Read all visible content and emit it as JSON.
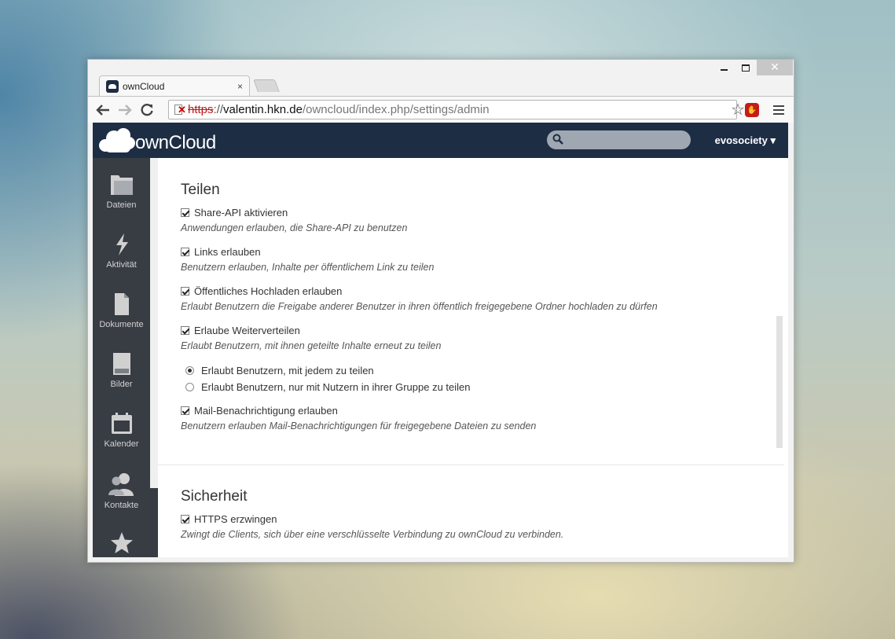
{
  "tab": {
    "title": "ownCloud",
    "close": "×"
  },
  "address": {
    "scheme": "https",
    "sep": "://",
    "host": "valentin.hkn.de",
    "path": "/owncloud/index.php/settings/admin"
  },
  "header": {
    "logo_text": "ownCloud",
    "search_placeholder": "",
    "user": "evosociety ▾"
  },
  "nav": [
    {
      "label": "Dateien",
      "icon": "folder-icon"
    },
    {
      "label": "Aktivität",
      "icon": "lightning-icon"
    },
    {
      "label": "Dokumente",
      "icon": "document-icon"
    },
    {
      "label": "Bilder",
      "icon": "image-icon"
    },
    {
      "label": "Kalender",
      "icon": "calendar-icon"
    },
    {
      "label": "Kontakte",
      "icon": "contacts-icon"
    },
    {
      "label": "",
      "icon": "star-icon"
    }
  ],
  "sharing": {
    "title": "Teilen",
    "options": [
      {
        "label": "Share-API aktivieren",
        "hint": "Anwendungen erlauben, die Share-API zu benutzen",
        "checked": true
      },
      {
        "label": "Links erlauben",
        "hint": "Benutzern erlauben, Inhalte per öffentlichem Link zu teilen",
        "checked": true
      },
      {
        "label": "Öffentliches Hochladen erlauben",
        "hint": "Erlaubt Benutzern die Freigabe anderer Benutzer in ihren öffentlich freigegebene Ordner hochladen zu dürfen",
        "checked": true
      },
      {
        "label": "Erlaube Weiterverteilen",
        "hint": "Erlaubt Benutzern, mit ihnen geteilte Inhalte erneut zu teilen",
        "checked": true
      }
    ],
    "radios": [
      {
        "label": "Erlaubt Benutzern, mit jedem zu teilen",
        "checked": true
      },
      {
        "label": "Erlaubt Benutzern, nur mit Nutzern in ihrer Gruppe zu teilen",
        "checked": false
      }
    ],
    "mail": {
      "label": "Mail-Benachrichtigung erlauben",
      "hint": "Benutzern erlauben Mail-Benachrichtigungen für freigegebene Dateien zu senden",
      "checked": true
    }
  },
  "security": {
    "title": "Sicherheit",
    "https": {
      "label": "HTTPS erzwingen",
      "hint": "Zwingt die Clients, sich über eine verschlüsselte Verbindung zu ownCloud zu verbinden.",
      "checked": true
    }
  },
  "colors": {
    "header_bg": "#1d2d44",
    "nav_bg": "#383c43",
    "accent_red": "#c41b1b"
  }
}
